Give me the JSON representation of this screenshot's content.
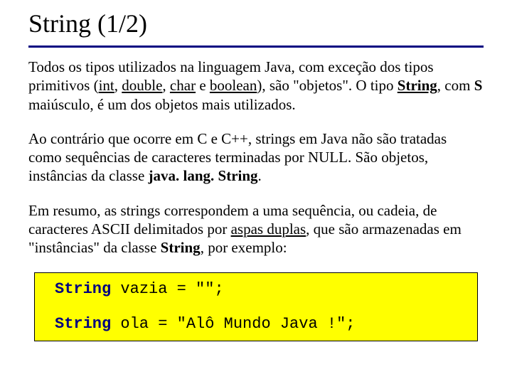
{
  "title": "String (1/2)",
  "p1": {
    "t1": "Todos os tipos utilizados na linguagem Java, com exceção dos tipos primitivos (",
    "int": "int",
    "c1": ", ",
    "double": "double",
    "c2": ", ",
    "char": "char",
    "e": " e ",
    "boolean": "boolean",
    "t2": "), são \"objetos\". O tipo ",
    "string": "String",
    "t3": ", com ",
    "s": "S",
    "t4": " maiúsculo, é um dos objetos mais utilizados."
  },
  "p2": {
    "t1": "Ao contrário que ocorre em C e C++, strings em Java não são tratadas como sequências de caracteres terminadas por NULL. São objetos, instâncias da classe ",
    "cls": "java. lang. String",
    "t2": "."
  },
  "p3": {
    "t1": "Em resumo, as strings correspondem a uma sequência, ou cadeia, de caracteres ASCII delimitados por ",
    "aspas": "aspas duplas",
    "t2": ", que são armazenadas em \"instâncias\" da classe ",
    "string": "String",
    "t3": ", por exemplo:"
  },
  "code": {
    "l1kw": "String",
    "l1rest": " vazia = \"\";",
    "l2kw": "String",
    "l2rest": " ola = \"Alô Mundo Java !\";"
  }
}
